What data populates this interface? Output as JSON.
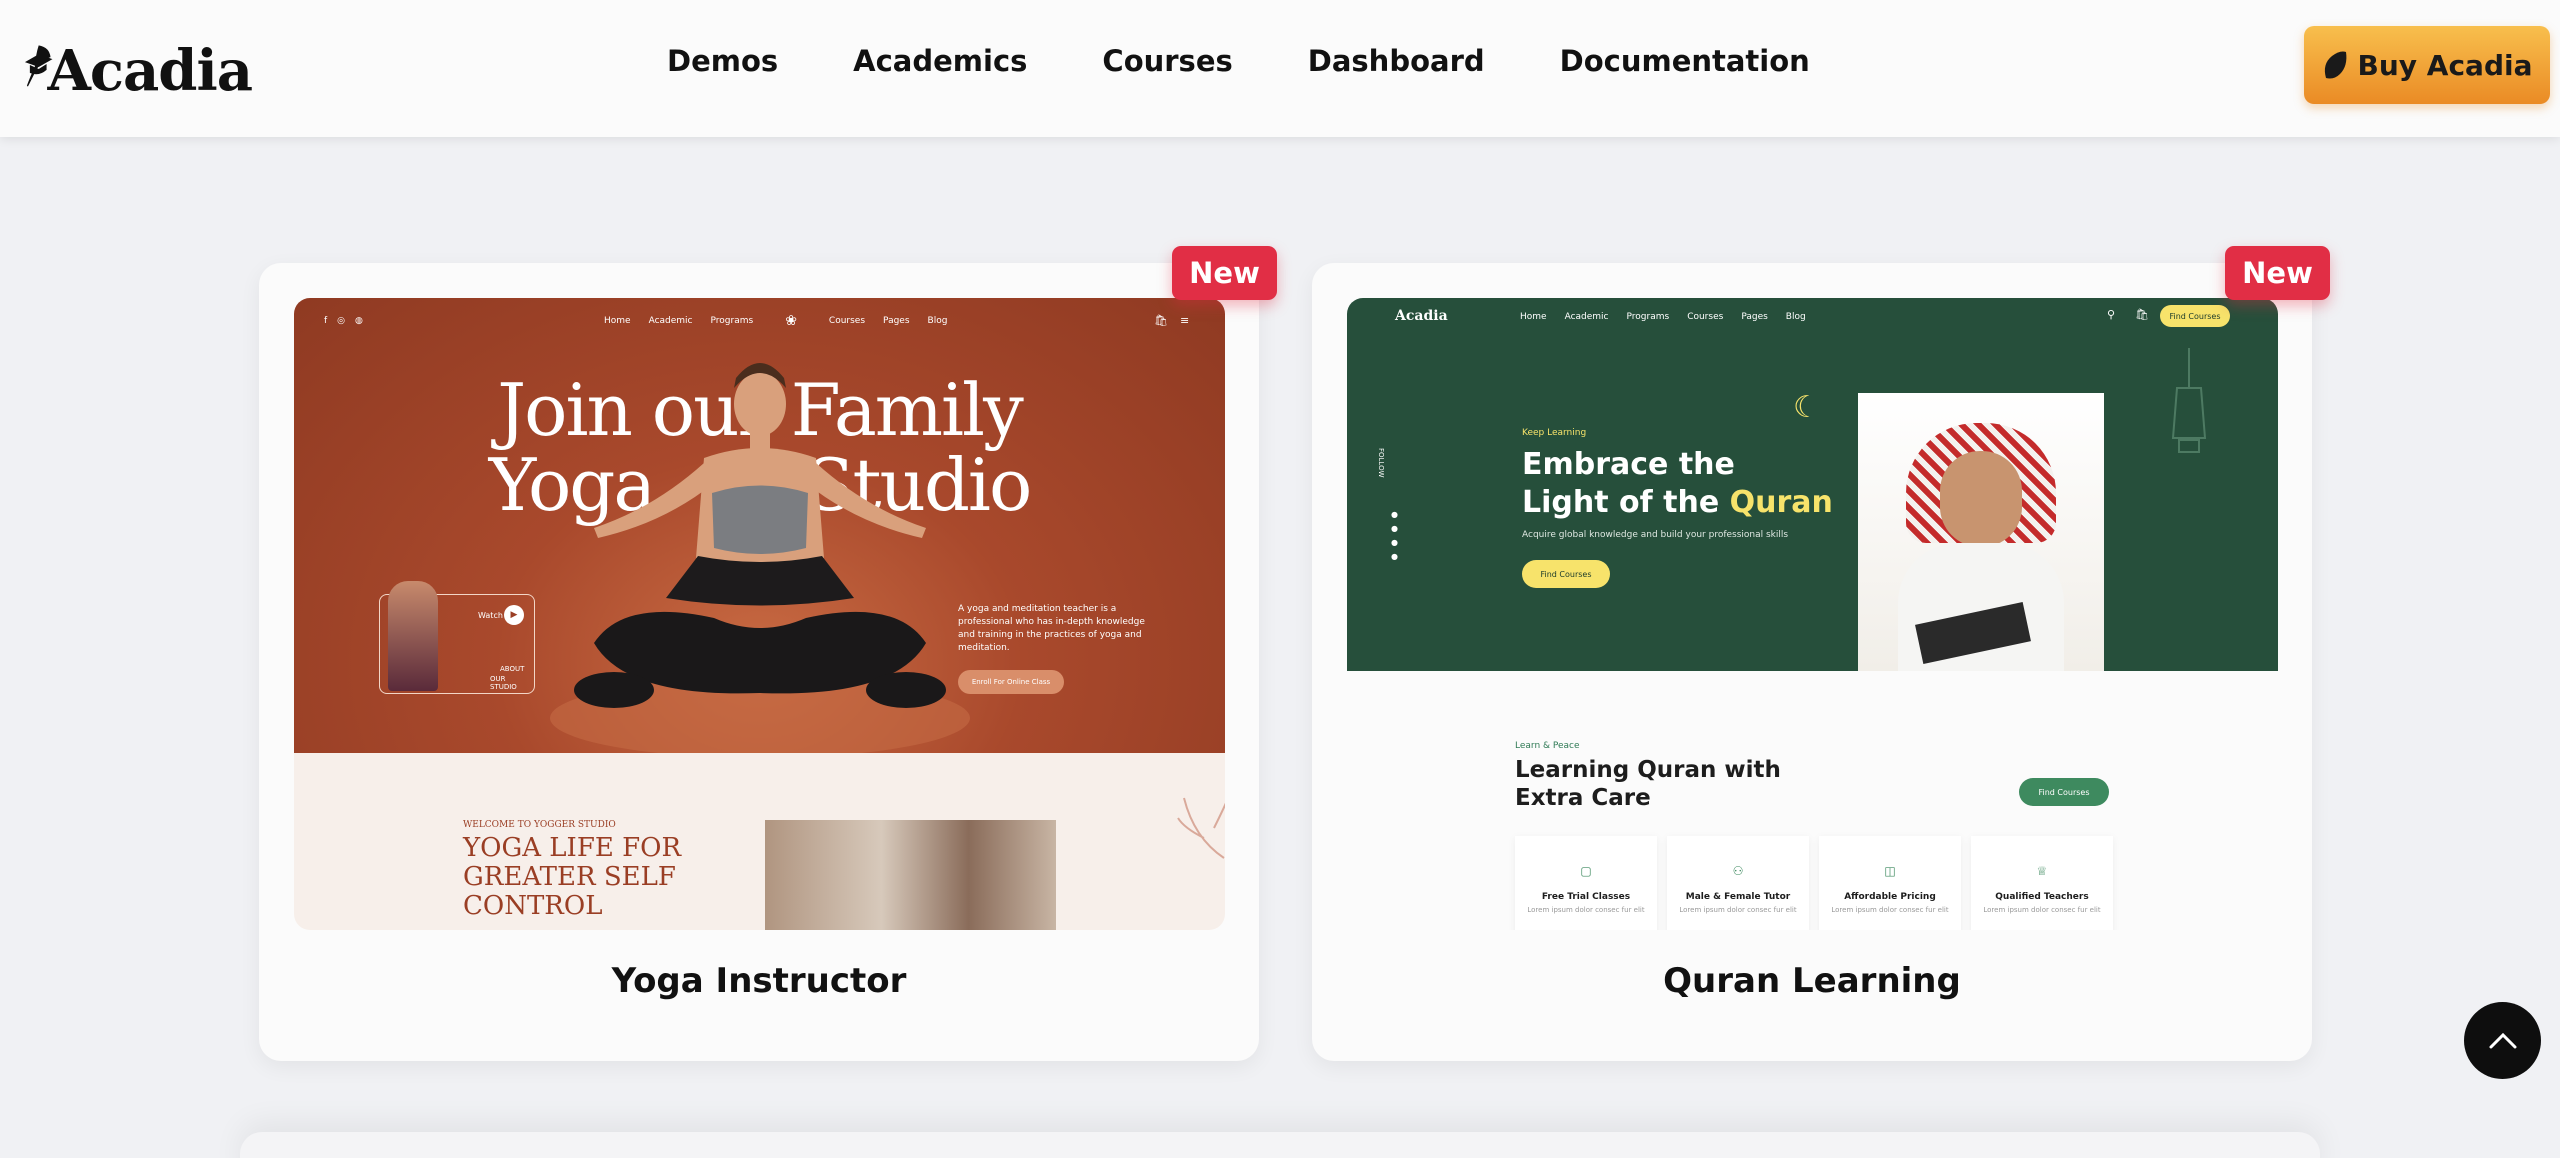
{
  "brand": {
    "name": "Acadia",
    "logo_icon": "graduation-cap-quill-icon"
  },
  "nav": {
    "items": [
      {
        "label": "Demos"
      },
      {
        "label": "Academics"
      },
      {
        "label": "Courses"
      },
      {
        "label": "Dashboard"
      },
      {
        "label": "Documentation"
      }
    ]
  },
  "buy_button": {
    "label": "Buy Acadia",
    "icon": "leaf-icon"
  },
  "colors": {
    "accent": "#f0a43a",
    "badge": "#e12e45",
    "yoga": "#9a3e24",
    "quran": "#244f3a",
    "quran_accent": "#f7e36b"
  },
  "cards": [
    {
      "title": "Yoga Instructor",
      "badge": "New",
      "preview": {
        "nav": [
          "Home",
          "Academic",
          "Programs",
          "Courses",
          "Pages",
          "Blog"
        ],
        "hero_line1": "Join our Family",
        "hero_line2": "Yoga Studio",
        "description": "A yoga and meditation teacher is a professional who has in-depth knowledge and training in the practices of yoga and meditation.",
        "cta": "Enroll For Online Class",
        "watch": "Watch",
        "about_line1": "ABOUT",
        "about_line2": "OUR STUDIO",
        "section_kicker": "WELCOME TO YOGGER STUDIO",
        "section_line1": "YOGA LIFE FOR",
        "section_line2": "GREATER SELF",
        "section_line3": "CONTROL"
      }
    },
    {
      "title": "Quran Learning",
      "badge": "New",
      "preview": {
        "logo": "Acadia",
        "nav": [
          "Home",
          "Academic",
          "Programs",
          "Courses",
          "Pages",
          "Blog"
        ],
        "nav_button": "Find Courses",
        "follow": "FOLLOW",
        "kicker": "Keep Learning",
        "hero_line1": "Embrace the",
        "hero_line2_a": "Light of the ",
        "hero_line2_b": "Quran",
        "subtitle": "Acquire global knowledge and build your professional skills",
        "cta": "Find Courses",
        "section_kicker": "Learn & Peace",
        "section_line1": "Learning Quran with",
        "section_line2": "Extra Care",
        "section_cta": "Find Courses",
        "features": [
          "Free Trial Classes",
          "Male & Female Tutor",
          "Affordable Pricing",
          "Qualified Teachers"
        ],
        "feature_text": "Lorem ipsum dolor consec fur elit"
      }
    }
  ],
  "scroll_top": {
    "icon": "chevron-up-icon"
  }
}
